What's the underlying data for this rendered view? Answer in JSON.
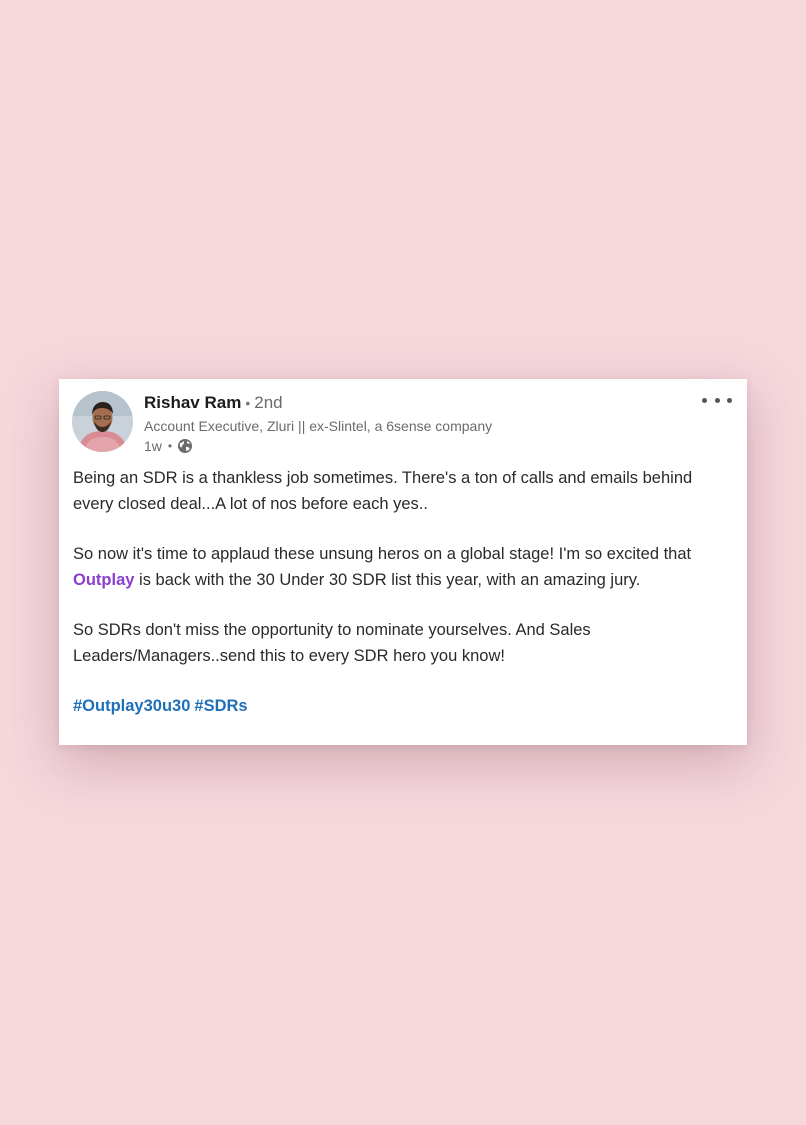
{
  "post": {
    "author": {
      "name": "Rishav Ram",
      "separator": "•",
      "degree": "2nd",
      "headline": "Account Executive, Zluri || ex-Slintel, a 6sense company",
      "time": "1w",
      "visibility_icon": "globe-icon"
    },
    "more_icon": "ellipsis-icon",
    "paragraphs": {
      "p1": "Being an SDR is a thankless job sometimes. There's a ton of calls and emails behind every closed deal...A lot of nos before each yes..",
      "p2_before": "So now it's time to applaud these unsung heros on a global stage! I'm so excited that ",
      "p2_mention": "Outplay",
      "p2_after": " is back with the 30 Under 30 SDR list this year, with an amazing jury.",
      "p3": "So SDRs don't miss the opportunity to nominate yourselves. And Sales Leaders/Managers..send this to every SDR hero you know!"
    },
    "hashtags": [
      "#Outplay30u30",
      "#SDRs"
    ]
  },
  "colors": {
    "background": "#f5d7dc",
    "mention": "#8a3fd0",
    "hashtag": "#1f6fb8"
  }
}
